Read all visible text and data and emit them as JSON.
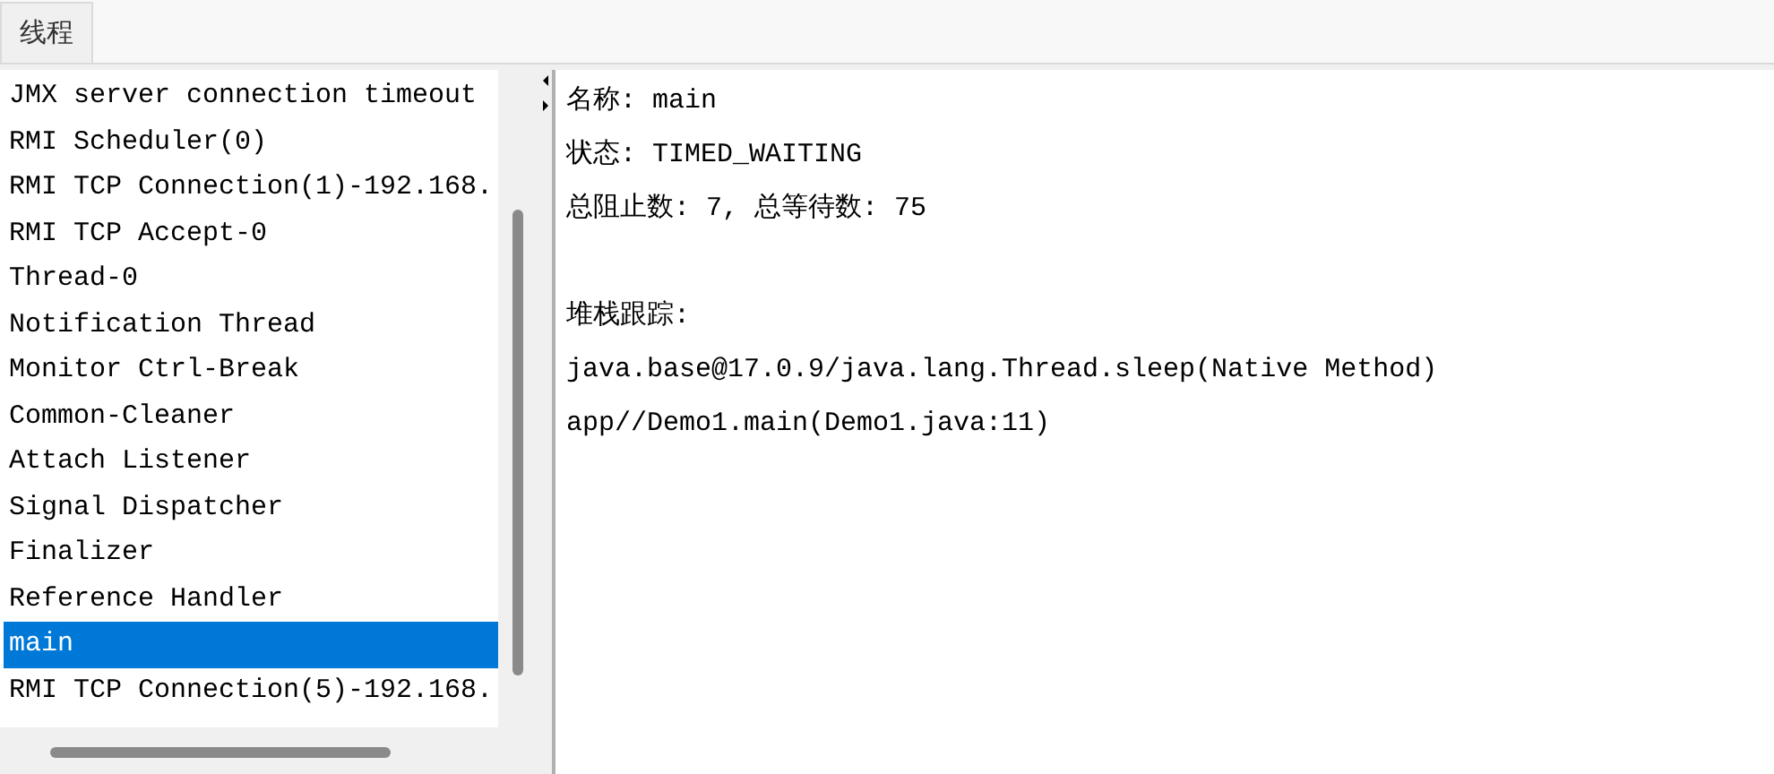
{
  "tabs": [
    {
      "label": "线程",
      "selected": true
    }
  ],
  "threads": [
    {
      "name": "JMX server connection timeout",
      "selected": false
    },
    {
      "name": "RMI Scheduler(0)",
      "selected": false
    },
    {
      "name": "RMI TCP Connection(1)-192.168.",
      "selected": false
    },
    {
      "name": "RMI TCP Accept-0",
      "selected": false
    },
    {
      "name": "Thread-0",
      "selected": false
    },
    {
      "name": "Notification Thread",
      "selected": false
    },
    {
      "name": "Monitor Ctrl-Break",
      "selected": false
    },
    {
      "name": "Common-Cleaner",
      "selected": false
    },
    {
      "name": "Attach Listener",
      "selected": false
    },
    {
      "name": "Signal Dispatcher",
      "selected": false
    },
    {
      "name": "Finalizer",
      "selected": false
    },
    {
      "name": "Reference Handler",
      "selected": false
    },
    {
      "name": "main",
      "selected": true
    },
    {
      "name": "RMI TCP Connection(5)-192.168.",
      "selected": false
    }
  ],
  "details": {
    "info": [
      "名称: main",
      "状态: TIMED_WAITING",
      "总阻止数: 7, 总等待数: 75"
    ],
    "stack_title": "堆栈跟踪:",
    "stack": [
      "java.base@17.0.9/java.lang.Thread.sleep(Native Method)",
      "app//Demo1.main(Demo1.java:11)"
    ]
  }
}
